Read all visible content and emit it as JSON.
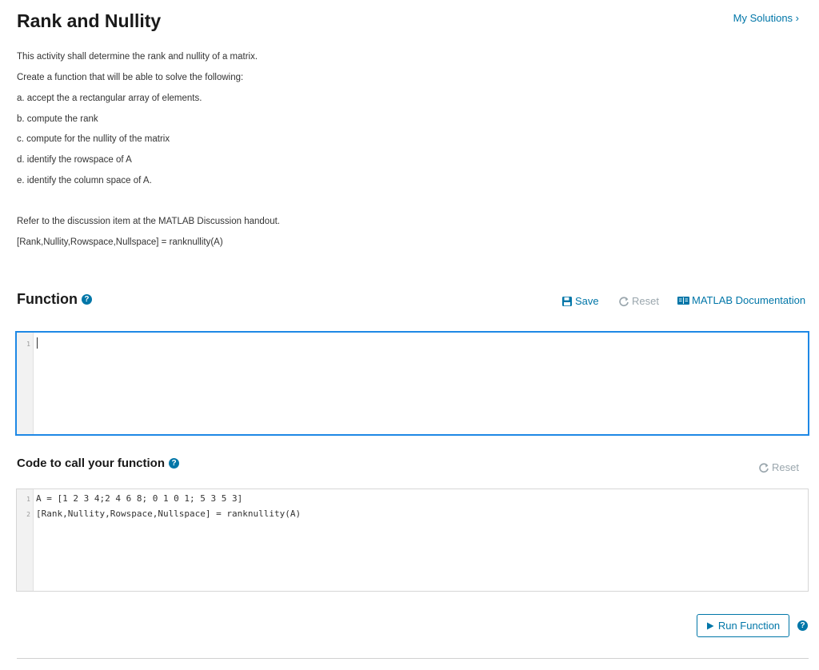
{
  "page": {
    "title": "Rank and Nullity",
    "my_solutions": "My Solutions ›"
  },
  "description": {
    "lines": [
      "This activity shall determine the rank and nullity of a matrix.",
      "Create a function that will be able to solve the following:",
      "a. accept the a rectangular array of elements.",
      "b. compute the rank",
      "c. compute for the nullity of the matrix",
      "d. identify the rowspace of A",
      "e. identify the column space of A.",
      "Refer to the discussion item at the MATLAB Discussion handout.",
      "[Rank,Nullity,Rowspace,Nullspace] = ranknullity(A)"
    ]
  },
  "function_section": {
    "title": "Function",
    "save_label": "Save",
    "reset_label": "Reset",
    "docs_label": "MATLAB Documentation",
    "editor": {
      "line_numbers": [
        "1"
      ],
      "lines": [
        ""
      ]
    }
  },
  "call_section": {
    "title": "Code to call your function",
    "reset_label": "Reset",
    "editor": {
      "line_numbers": [
        "1",
        "2"
      ],
      "lines": [
        "A = [1 2 3 4;2 4 6 8; 0 1 0 1; 5 3 5 3]",
        "[Rank,Nullity,Rowspace,Nullspace] = ranknullity(A)"
      ]
    }
  },
  "actions": {
    "run_label": "Run Function"
  },
  "colors": {
    "accent": "#0076a8",
    "active_editor_border": "#1e88e5",
    "disabled": "#9aa6ad"
  },
  "icons": {
    "help": "question-circle-icon",
    "save": "floppy-disk-icon",
    "reset": "refresh-icon",
    "docs": "book-icon",
    "run": "play-icon"
  }
}
